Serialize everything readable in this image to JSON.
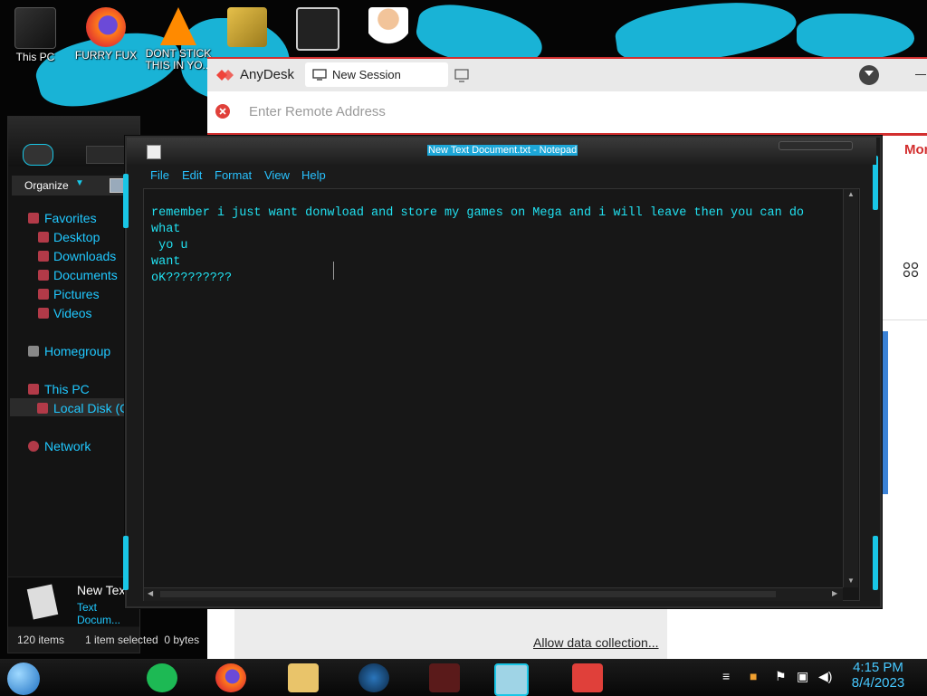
{
  "desktop": {
    "icons": [
      {
        "label": "This PC",
        "icon": "computer-icon"
      },
      {
        "label": "FURRY FUX",
        "icon": "firefox-icon"
      },
      {
        "label": "DONT STICK THIS IN YO...",
        "icon": "vlc-icon"
      },
      {
        "label": "",
        "icon": "hxd-editor-icon"
      },
      {
        "label": "",
        "icon": "game-shortcut-icon"
      },
      {
        "label": "",
        "icon": "doctor-icon"
      }
    ]
  },
  "anydesk": {
    "app_title": "AnyDesk",
    "tab_label": "New Session",
    "address_placeholder": "Enter Remote Address",
    "more_label": "Mor",
    "allow_link": "Allow data collection...",
    "accent": "#d32f2f"
  },
  "explorer": {
    "organize_label": "Organize",
    "nav": {
      "favorites": "Favorites",
      "desktop": "Desktop",
      "downloads": "Downloads",
      "documents": "Documents",
      "pictures": "Pictures",
      "videos": "Videos",
      "homegroup": "Homegroup",
      "this_pc": "This PC",
      "local_disk": "Local Disk (C:",
      "network": "Network"
    },
    "details": {
      "file_name": "New Tex",
      "file_type": "Text Docum..."
    },
    "status": {
      "items": "120 items",
      "selected": "1 item selected  0 bytes"
    }
  },
  "notepad": {
    "title": "New Text Document.txt - Notepad",
    "menu": [
      "File",
      "Edit",
      "Format",
      "View",
      "Help"
    ],
    "content": "remember i just want donwload and store my games on Mega and i will leave then you can do what\n yo u\nwant\noK?????????",
    "text_color": "#21e0f0"
  },
  "taskbar": {
    "apps": [
      "spotify-icon",
      "firefox-icon",
      "file-explorer-icon",
      "steam-icon",
      "game-icon",
      "notepad-icon",
      "anydesk-icon"
    ],
    "time": "4:15 PM",
    "date": "8/4/2023"
  }
}
